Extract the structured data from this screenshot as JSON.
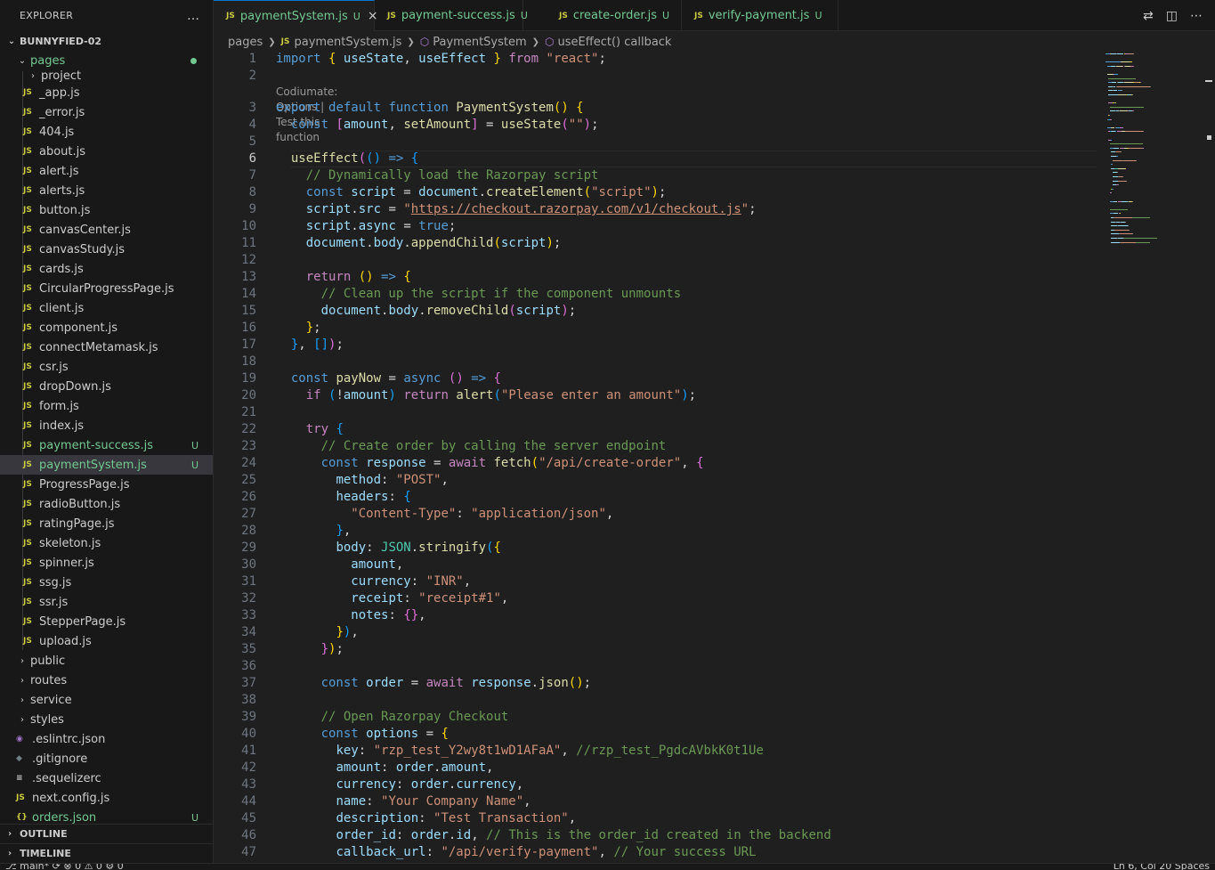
{
  "explorer": {
    "title": "EXPLORER",
    "more": "…",
    "root": "BUNNYFIED-02",
    "folder_open": "pages",
    "subfolder": "project",
    "files": [
      {
        "name": "_app.js",
        "icon": "JS",
        "status": ""
      },
      {
        "name": "_error.js",
        "icon": "JS",
        "status": ""
      },
      {
        "name": "404.js",
        "icon": "JS",
        "status": ""
      },
      {
        "name": "about.js",
        "icon": "JS",
        "status": ""
      },
      {
        "name": "alert.js",
        "icon": "JS",
        "status": ""
      },
      {
        "name": "alerts.js",
        "icon": "JS",
        "status": ""
      },
      {
        "name": "button.js",
        "icon": "JS",
        "status": ""
      },
      {
        "name": "canvasCenter.js",
        "icon": "JS",
        "status": ""
      },
      {
        "name": "canvasStudy.js",
        "icon": "JS",
        "status": ""
      },
      {
        "name": "cards.js",
        "icon": "JS",
        "status": ""
      },
      {
        "name": "CircularProgressPage.js",
        "icon": "JS",
        "status": ""
      },
      {
        "name": "client.js",
        "icon": "JS",
        "status": ""
      },
      {
        "name": "component.js",
        "icon": "JS",
        "status": ""
      },
      {
        "name": "connectMetamask.js",
        "icon": "JS",
        "status": ""
      },
      {
        "name": "csr.js",
        "icon": "JS",
        "status": ""
      },
      {
        "name": "dropDown.js",
        "icon": "JS",
        "status": ""
      },
      {
        "name": "form.js",
        "icon": "JS",
        "status": ""
      },
      {
        "name": "index.js",
        "icon": "JS",
        "status": ""
      },
      {
        "name": "payment-success.js",
        "icon": "JS",
        "status": "U"
      },
      {
        "name": "paymentSystem.js",
        "icon": "JS",
        "status": "U"
      },
      {
        "name": "ProgressPage.js",
        "icon": "JS",
        "status": ""
      },
      {
        "name": "radioButton.js",
        "icon": "JS",
        "status": ""
      },
      {
        "name": "ratingPage.js",
        "icon": "JS",
        "status": ""
      },
      {
        "name": "skeleton.js",
        "icon": "JS",
        "status": ""
      },
      {
        "name": "spinner.js",
        "icon": "JS",
        "status": ""
      },
      {
        "name": "ssg.js",
        "icon": "JS",
        "status": ""
      },
      {
        "name": "ssr.js",
        "icon": "JS",
        "status": ""
      },
      {
        "name": "StepperPage.js",
        "icon": "JS",
        "status": ""
      },
      {
        "name": "upload.js",
        "icon": "JS",
        "status": ""
      }
    ],
    "folders": [
      "public",
      "routes",
      "service",
      "styles"
    ],
    "root_files": [
      {
        "name": ".eslintrc.json",
        "icon": "◉",
        "color": "#a074c4",
        "status": ""
      },
      {
        "name": ".gitignore",
        "icon": "◆",
        "color": "#6d8086",
        "status": ""
      },
      {
        "name": ".sequelizerc",
        "icon": "≡",
        "color": "#cccccc",
        "status": ""
      },
      {
        "name": "next.config.js",
        "icon": "JS",
        "color": "#cbcb41",
        "status": ""
      },
      {
        "name": "orders.json",
        "icon": "{}",
        "color": "#cbcb41",
        "status": "U"
      }
    ],
    "outline": "OUTLINE",
    "timeline": "TIMELINE"
  },
  "tabs": [
    {
      "label": "paymentSystem.js",
      "status": "U",
      "active": true
    },
    {
      "label": "payment-success.js",
      "status": "U",
      "active": false
    },
    {
      "label": "create-order.js",
      "status": "U",
      "active": false
    },
    {
      "label": "verify-payment.js",
      "status": "U",
      "active": false
    }
  ],
  "breadcrumb": {
    "folder": "pages",
    "file": "paymentSystem.js",
    "symbol1": "PaymentSystem",
    "symbol2": "useEffect() callback"
  },
  "codelens": "Codiumate: Options | Test this function",
  "current_line": 6,
  "code_lines": [
    [
      [
        1,
        ""
      ],
      [
        "kb",
        "import "
      ],
      [
        "p1",
        "{ "
      ],
      [
        "v",
        "useState"
      ],
      [
        "w",
        ", "
      ],
      [
        "v",
        "useEffect"
      ],
      [
        "p1",
        " }"
      ],
      [
        "k",
        " from "
      ],
      [
        "s",
        "\"react\""
      ],
      [
        "w",
        ";"
      ]
    ],
    [
      [
        2,
        ""
      ]
    ],
    [
      [
        3,
        ""
      ],
      [
        "kb",
        "export "
      ],
      [
        "kb",
        "default "
      ],
      [
        "kb",
        "function "
      ],
      [
        "f",
        "PaymentSystem"
      ],
      [
        "p1",
        "() {"
      ]
    ],
    [
      [
        4,
        ""
      ],
      [
        "w",
        "  "
      ],
      [
        "kb",
        "const "
      ],
      [
        "p2",
        "["
      ],
      [
        "v",
        "amount"
      ],
      [
        "w",
        ", "
      ],
      [
        "f",
        "setAmount"
      ],
      [
        "p2",
        "]"
      ],
      [
        "w",
        " = "
      ],
      [
        "f",
        "useState"
      ],
      [
        "p2",
        "("
      ],
      [
        "s",
        "\"\""
      ],
      [
        "p2",
        ")"
      ],
      [
        "w",
        ";"
      ]
    ],
    [
      [
        5,
        ""
      ]
    ],
    [
      [
        6,
        ""
      ],
      [
        "w",
        "  "
      ],
      [
        "f",
        "useEffect"
      ],
      [
        "p2",
        "("
      ],
      [
        "p3",
        "() "
      ],
      [
        "kb",
        "=> "
      ],
      [
        "p3",
        "{"
      ]
    ],
    [
      [
        7,
        ""
      ],
      [
        "w",
        "    "
      ],
      [
        "c",
        "// Dynamically load the Razorpay script"
      ]
    ],
    [
      [
        8,
        ""
      ],
      [
        "w",
        "    "
      ],
      [
        "kb",
        "const "
      ],
      [
        "v",
        "script"
      ],
      [
        "w",
        " = "
      ],
      [
        "v",
        "document"
      ],
      [
        "w",
        "."
      ],
      [
        "f",
        "createElement"
      ],
      [
        "p1",
        "("
      ],
      [
        "s",
        "\"script\""
      ],
      [
        "p1",
        ")"
      ],
      [
        "w",
        ";"
      ]
    ],
    [
      [
        9,
        ""
      ],
      [
        "w",
        "    "
      ],
      [
        "v",
        "script"
      ],
      [
        "w",
        "."
      ],
      [
        "v",
        "src"
      ],
      [
        "w",
        " = "
      ],
      [
        "s",
        "\""
      ],
      [
        "s ul",
        "https://checkout.razorpay.com/v1/checkout.js"
      ],
      [
        "s",
        "\""
      ],
      [
        "w",
        ";"
      ]
    ],
    [
      [
        10,
        ""
      ],
      [
        "w",
        "    "
      ],
      [
        "v",
        "script"
      ],
      [
        "w",
        "."
      ],
      [
        "v",
        "async"
      ],
      [
        "w",
        " = "
      ],
      [
        "kb",
        "true"
      ],
      [
        "w",
        ";"
      ]
    ],
    [
      [
        11,
        ""
      ],
      [
        "w",
        "    "
      ],
      [
        "v",
        "document"
      ],
      [
        "w",
        "."
      ],
      [
        "v",
        "body"
      ],
      [
        "w",
        "."
      ],
      [
        "f",
        "appendChild"
      ],
      [
        "p1",
        "("
      ],
      [
        "v",
        "script"
      ],
      [
        "p1",
        ")"
      ],
      [
        "w",
        ";"
      ]
    ],
    [
      [
        12,
        ""
      ]
    ],
    [
      [
        13,
        ""
      ],
      [
        "w",
        "    "
      ],
      [
        "k",
        "return "
      ],
      [
        "p1",
        "() "
      ],
      [
        "kb",
        "=> "
      ],
      [
        "p1",
        "{"
      ]
    ],
    [
      [
        14,
        ""
      ],
      [
        "w",
        "      "
      ],
      [
        "c",
        "// Clean up the script if the component unmounts"
      ]
    ],
    [
      [
        15,
        ""
      ],
      [
        "w",
        "      "
      ],
      [
        "v",
        "document"
      ],
      [
        "w",
        "."
      ],
      [
        "v",
        "body"
      ],
      [
        "w",
        "."
      ],
      [
        "f",
        "removeChild"
      ],
      [
        "p2",
        "("
      ],
      [
        "v",
        "script"
      ],
      [
        "p2",
        ")"
      ],
      [
        "w",
        ";"
      ]
    ],
    [
      [
        16,
        ""
      ],
      [
        "w",
        "    "
      ],
      [
        "p1",
        "}"
      ],
      [
        "w",
        ";"
      ]
    ],
    [
      [
        17,
        ""
      ],
      [
        "w",
        "  "
      ],
      [
        "p3",
        "}"
      ],
      [
        "w",
        ", "
      ],
      [
        "p3",
        "[]"
      ],
      [
        "p2",
        ")"
      ],
      [
        "w",
        ";"
      ]
    ],
    [
      [
        18,
        ""
      ]
    ],
    [
      [
        19,
        ""
      ],
      [
        "w",
        "  "
      ],
      [
        "kb",
        "const "
      ],
      [
        "f",
        "payNow"
      ],
      [
        "w",
        " = "
      ],
      [
        "kb",
        "async "
      ],
      [
        "p2",
        "() "
      ],
      [
        "kb",
        "=> "
      ],
      [
        "p2",
        "{"
      ]
    ],
    [
      [
        20,
        ""
      ],
      [
        "w",
        "    "
      ],
      [
        "k",
        "if "
      ],
      [
        "p3",
        "("
      ],
      [
        "w",
        "!"
      ],
      [
        "v",
        "amount"
      ],
      [
        "p3",
        ")"
      ],
      [
        "k",
        " return "
      ],
      [
        "f",
        "alert"
      ],
      [
        "p3",
        "("
      ],
      [
        "s",
        "\"Please enter an amount\""
      ],
      [
        "p3",
        ")"
      ],
      [
        "w",
        ";"
      ]
    ],
    [
      [
        21,
        ""
      ]
    ],
    [
      [
        22,
        ""
      ],
      [
        "w",
        "    "
      ],
      [
        "k",
        "try "
      ],
      [
        "p3",
        "{"
      ]
    ],
    [
      [
        23,
        ""
      ],
      [
        "w",
        "      "
      ],
      [
        "c",
        "// Create order by calling the server endpoint"
      ]
    ],
    [
      [
        24,
        ""
      ],
      [
        "w",
        "      "
      ],
      [
        "kb",
        "const "
      ],
      [
        "v",
        "response"
      ],
      [
        "w",
        " = "
      ],
      [
        "k",
        "await "
      ],
      [
        "f",
        "fetch"
      ],
      [
        "p1",
        "("
      ],
      [
        "s",
        "\"/api/create-order\""
      ],
      [
        "w",
        ", "
      ],
      [
        "p2",
        "{"
      ]
    ],
    [
      [
        25,
        ""
      ],
      [
        "w",
        "        "
      ],
      [
        "v",
        "method"
      ],
      [
        "w",
        ": "
      ],
      [
        "s",
        "\"POST\""
      ],
      [
        "w",
        ","
      ]
    ],
    [
      [
        26,
        ""
      ],
      [
        "w",
        "        "
      ],
      [
        "v",
        "headers"
      ],
      [
        "w",
        ": "
      ],
      [
        "p3",
        "{"
      ]
    ],
    [
      [
        27,
        ""
      ],
      [
        "w",
        "          "
      ],
      [
        "s",
        "\"Content-Type\""
      ],
      [
        "w",
        ": "
      ],
      [
        "s",
        "\"application/json\""
      ],
      [
        "w",
        ","
      ]
    ],
    [
      [
        28,
        ""
      ],
      [
        "w",
        "        "
      ],
      [
        "p3",
        "}"
      ],
      [
        "w",
        ","
      ]
    ],
    [
      [
        29,
        ""
      ],
      [
        "w",
        "        "
      ],
      [
        "v",
        "body"
      ],
      [
        "w",
        ": "
      ],
      [
        "t",
        "JSON"
      ],
      [
        "w",
        "."
      ],
      [
        "f",
        "stringify"
      ],
      [
        "p3",
        "("
      ],
      [
        "p1",
        "{"
      ]
    ],
    [
      [
        30,
        ""
      ],
      [
        "w",
        "          "
      ],
      [
        "v",
        "amount"
      ],
      [
        "w",
        ","
      ]
    ],
    [
      [
        31,
        ""
      ],
      [
        "w",
        "          "
      ],
      [
        "v",
        "currency"
      ],
      [
        "w",
        ": "
      ],
      [
        "s",
        "\"INR\""
      ],
      [
        "w",
        ","
      ]
    ],
    [
      [
        32,
        ""
      ],
      [
        "w",
        "          "
      ],
      [
        "v",
        "receipt"
      ],
      [
        "w",
        ": "
      ],
      [
        "s",
        "\"receipt#1\""
      ],
      [
        "w",
        ","
      ]
    ],
    [
      [
        33,
        ""
      ],
      [
        "w",
        "          "
      ],
      [
        "v",
        "notes"
      ],
      [
        "w",
        ": "
      ],
      [
        "p2",
        "{}"
      ],
      [
        "w",
        ","
      ]
    ],
    [
      [
        34,
        ""
      ],
      [
        "w",
        "        "
      ],
      [
        "p1",
        "}"
      ],
      [
        "p3",
        ")"
      ],
      [
        "w",
        ","
      ]
    ],
    [
      [
        35,
        ""
      ],
      [
        "w",
        "      "
      ],
      [
        "p2",
        "}"
      ],
      [
        "p1",
        ")"
      ],
      [
        "w",
        ";"
      ]
    ],
    [
      [
        36,
        ""
      ]
    ],
    [
      [
        37,
        ""
      ],
      [
        "w",
        "      "
      ],
      [
        "kb",
        "const "
      ],
      [
        "v",
        "order"
      ],
      [
        "w",
        " = "
      ],
      [
        "k",
        "await "
      ],
      [
        "v",
        "response"
      ],
      [
        "w",
        "."
      ],
      [
        "f",
        "json"
      ],
      [
        "p1",
        "()"
      ],
      [
        "w",
        ";"
      ]
    ],
    [
      [
        38,
        ""
      ]
    ],
    [
      [
        39,
        ""
      ],
      [
        "w",
        "      "
      ],
      [
        "c",
        "// Open Razorpay Checkout"
      ]
    ],
    [
      [
        40,
        ""
      ],
      [
        "w",
        "      "
      ],
      [
        "kb",
        "const "
      ],
      [
        "v",
        "options"
      ],
      [
        "w",
        " = "
      ],
      [
        "p1",
        "{"
      ]
    ],
    [
      [
        41,
        ""
      ],
      [
        "w",
        "        "
      ],
      [
        "v",
        "key"
      ],
      [
        "w",
        ": "
      ],
      [
        "s",
        "\"rzp_test_Y2wy8t1wD1AFaA\""
      ],
      [
        "w",
        ", "
      ],
      [
        "c",
        "//rzp_test_PgdcAVbkK0t1Ue"
      ]
    ],
    [
      [
        42,
        ""
      ],
      [
        "w",
        "        "
      ],
      [
        "v",
        "amount"
      ],
      [
        "w",
        ": "
      ],
      [
        "v",
        "order"
      ],
      [
        "w",
        "."
      ],
      [
        "v",
        "amount"
      ],
      [
        "w",
        ","
      ]
    ],
    [
      [
        43,
        ""
      ],
      [
        "w",
        "        "
      ],
      [
        "v",
        "currency"
      ],
      [
        "w",
        ": "
      ],
      [
        "v",
        "order"
      ],
      [
        "w",
        "."
      ],
      [
        "v",
        "currency"
      ],
      [
        "w",
        ","
      ]
    ],
    [
      [
        44,
        ""
      ],
      [
        "w",
        "        "
      ],
      [
        "v",
        "name"
      ],
      [
        "w",
        ": "
      ],
      [
        "s",
        "\"Your Company Name\""
      ],
      [
        "w",
        ","
      ]
    ],
    [
      [
        45,
        ""
      ],
      [
        "w",
        "        "
      ],
      [
        "v",
        "description"
      ],
      [
        "w",
        ": "
      ],
      [
        "s",
        "\"Test Transaction\""
      ],
      [
        "w",
        ","
      ]
    ],
    [
      [
        46,
        ""
      ],
      [
        "w",
        "        "
      ],
      [
        "v",
        "order_id"
      ],
      [
        "w",
        ": "
      ],
      [
        "v",
        "order"
      ],
      [
        "w",
        "."
      ],
      [
        "v",
        "id"
      ],
      [
        "w",
        ", "
      ],
      [
        "c",
        "// This is the order_id created in the backend"
      ]
    ],
    [
      [
        47,
        ""
      ],
      [
        "w",
        "        "
      ],
      [
        "v",
        "callback_url"
      ],
      [
        "w",
        ": "
      ],
      [
        "s",
        "\"/api/verify-payment\""
      ],
      [
        "w",
        ", "
      ],
      [
        "c",
        "// Your success URL"
      ]
    ]
  ],
  "statusbar": {
    "left": "⎇ main*  ⟳  ⊗ 0 ⚠ 0  ⚙ 0",
    "right": "Ln 6, Col 20   Spaces"
  }
}
